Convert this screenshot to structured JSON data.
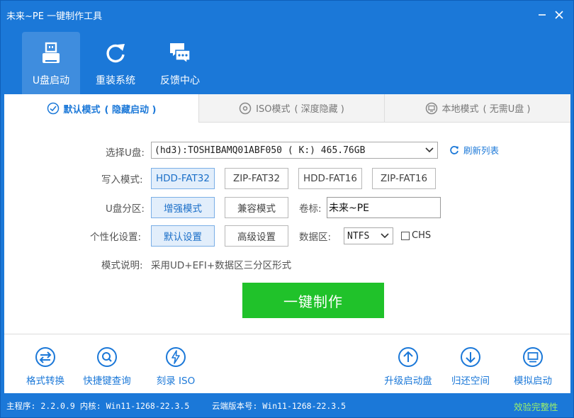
{
  "window": {
    "title": "未来~PE 一键制作工具"
  },
  "nav": [
    {
      "label": "U盘启动",
      "icon": "usb-drive-icon",
      "active": true
    },
    {
      "label": "重装系统",
      "icon": "reinstall-icon",
      "active": false
    },
    {
      "label": "反馈中心",
      "icon": "chat-icon",
      "active": false
    }
  ],
  "tabs": [
    {
      "label": "默认模式",
      "sub": "( 隐藏启动 )",
      "icon": "check-circle-icon",
      "active": true
    },
    {
      "label": "ISO模式",
      "sub": "( 深度隐藏 )",
      "icon": "disc-icon",
      "active": false
    },
    {
      "label": "本地模式",
      "sub": "( 无需U盘 )",
      "icon": "monitor-icon",
      "active": false
    }
  ],
  "form": {
    "select_disk_label": "选择U盘:",
    "disk_value": "(hd3):TOSHIBAMQ01ABF050 ( K:) 465.76GB",
    "refresh_label": "刷新列表",
    "write_mode_label": "写入模式:",
    "write_modes": [
      "HDD-FAT32",
      "ZIP-FAT32",
      "HDD-FAT16",
      "ZIP-FAT16"
    ],
    "partition_label": "U盘分区:",
    "partition_options": [
      "增强模式",
      "兼容模式"
    ],
    "volume_label": "卷标:",
    "volume_value": "未来~PE",
    "personal_label": "个性化设置:",
    "personal_options": [
      "默认设置",
      "高级设置"
    ],
    "data_area_label": "数据区:",
    "data_area_value": "NTFS",
    "chs_label": "CHS",
    "chs_checked": false,
    "mode_desc_label": "模式说明:",
    "mode_desc_value": "采用UD+EFI+数据区三分区形式"
  },
  "make_button": "一键制作",
  "tools_left": [
    {
      "label": "格式转换",
      "icon": "convert-icon"
    },
    {
      "label": "快捷键查询",
      "icon": "search-icon"
    },
    {
      "label": "刻录 ISO",
      "icon": "burn-icon"
    }
  ],
  "tools_right": [
    {
      "label": "升级启动盘",
      "icon": "upgrade-icon"
    },
    {
      "label": "归还空间",
      "icon": "restore-space-icon"
    },
    {
      "label": "模拟启动",
      "icon": "simulate-icon"
    }
  ],
  "status": {
    "main_program": "主程序: 2.2.0.9 内核: Win11-1268-22.3.5",
    "cloud_version": "云端版本号: Win11-1268-22.3.5",
    "verify": "效验完整性"
  },
  "colors": {
    "accent": "#1b78d8",
    "make": "#20c22a",
    "verify": "#9df26a"
  }
}
